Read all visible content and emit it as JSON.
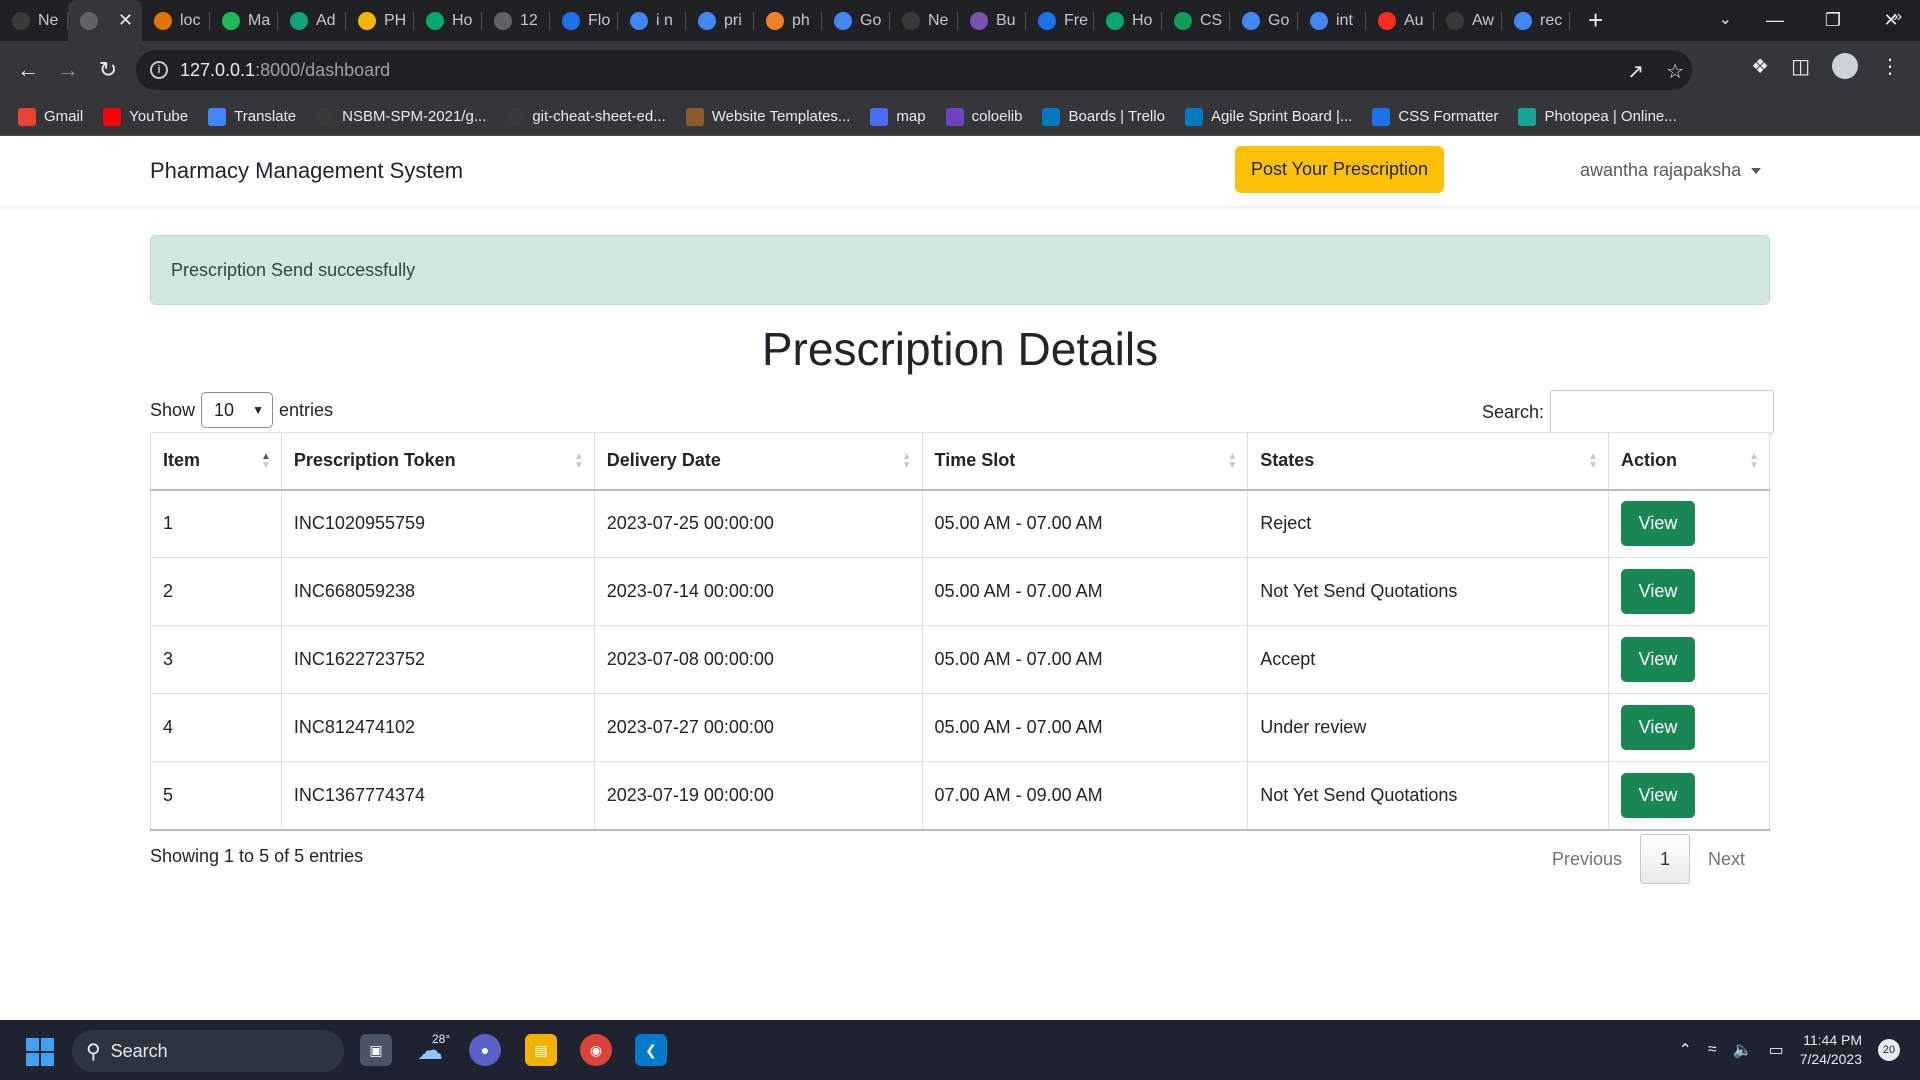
{
  "browser": {
    "tabs": [
      {
        "label": "Ne",
        "icon": "github-icon",
        "color": "#3a3a3a"
      },
      {
        "label": "",
        "icon": "globe-icon",
        "color": "#5f6368",
        "active": true
      },
      {
        "label": "loc",
        "icon": "flame-icon",
        "color": "#e37400"
      },
      {
        "label": "Ma",
        "icon": "m-icon",
        "color": "#1db954"
      },
      {
        "label": "Ad",
        "icon": "openai-icon",
        "color": "#10a37f"
      },
      {
        "label": "PH",
        "icon": "drive-icon",
        "color": "#f4b400"
      },
      {
        "label": "Ho",
        "icon": "w3-icon",
        "color": "#04aa6d"
      },
      {
        "label": "12",
        "icon": "globe-icon",
        "color": "#5f6368"
      },
      {
        "label": "Flo",
        "icon": "search-icon",
        "color": "#1a73e8"
      },
      {
        "label": "i n",
        "icon": "google-icon",
        "color": "#4285f4"
      },
      {
        "label": "pri",
        "icon": "google-icon",
        "color": "#4285f4"
      },
      {
        "label": "ph",
        "icon": "stack-icon",
        "color": "#f48024"
      },
      {
        "label": "Go",
        "icon": "translate-icon",
        "color": "#4285f4"
      },
      {
        "label": "Ne",
        "icon": "github-icon",
        "color": "#3a3a3a"
      },
      {
        "label": "Bu",
        "icon": "bootstrap-icon",
        "color": "#7952b3"
      },
      {
        "label": "Fre",
        "icon": "globe-icon",
        "color": "#1a73e8"
      },
      {
        "label": "Ho",
        "icon": "w3-icon",
        "color": "#04aa6d"
      },
      {
        "label": "CS",
        "icon": "w-icon",
        "color": "#0f9d58"
      },
      {
        "label": "Go",
        "icon": "translate-icon",
        "color": "#4285f4"
      },
      {
        "label": "int",
        "icon": "google-icon",
        "color": "#4285f4"
      },
      {
        "label": "Au",
        "icon": "laravel-icon",
        "color": "#ff2d20"
      },
      {
        "label": "Aw",
        "icon": "github-icon",
        "color": "#3a3a3a"
      },
      {
        "label": "rec",
        "icon": "google-icon",
        "color": "#4285f4"
      }
    ],
    "url_host": "127.0.0.1",
    "url_path": ":8000/dashboard",
    "bookmarks": [
      {
        "label": "Gmail",
        "icon": "gmail-icon",
        "color": "#ea4335"
      },
      {
        "label": "YouTube",
        "icon": "youtube-icon",
        "color": "#ff0000"
      },
      {
        "label": "Translate",
        "icon": "translate-icon",
        "color": "#4285f4"
      },
      {
        "label": "NSBM-SPM-2021/g...",
        "icon": "github-icon",
        "color": "#3a3a3a"
      },
      {
        "label": "git-cheat-sheet-ed...",
        "icon": "github-icon",
        "color": "#3a3a3a"
      },
      {
        "label": "Website Templates...",
        "icon": "template-icon",
        "color": "#8a5a2b"
      },
      {
        "label": "map",
        "icon": "map-icon",
        "color": "#4a6cf7"
      },
      {
        "label": "coloelib",
        "icon": "colorlib-icon",
        "color": "#6f42c1"
      },
      {
        "label": "Boards | Trello",
        "icon": "trello-icon",
        "color": "#0079bf"
      },
      {
        "label": "Agile Sprint Board |...",
        "icon": "trello-icon",
        "color": "#0079bf"
      },
      {
        "label": "CSS Formatter",
        "icon": "dans-tools-icon",
        "color": "#1a73e8"
      },
      {
        "label": "Photopea | Online...",
        "icon": "photopea-icon",
        "color": "#18a497"
      }
    ]
  },
  "navbar": {
    "brand": "Pharmacy Management System",
    "post_button": "Post Your Prescription",
    "user_name": "awantha rajapaksha"
  },
  "alert": {
    "message": "Prescription Send successfully"
  },
  "title": "Prescription Details",
  "table_controls": {
    "show_label": "Show",
    "entries_value": "10",
    "entries_label": "entries",
    "search_label": "Search:",
    "search_value": ""
  },
  "table": {
    "columns": [
      "Item",
      "Prescription Token",
      "Delivery Date",
      "Time Slot",
      "States",
      "Action"
    ],
    "rows": [
      {
        "item": "1",
        "token": "INC1020955759",
        "date": "2023-07-25 00:00:00",
        "slot": "05.00 AM - 07.00 AM",
        "state": "Reject",
        "action": "View"
      },
      {
        "item": "2",
        "token": "INC668059238",
        "date": "2023-07-14 00:00:00",
        "slot": "05.00 AM - 07.00 AM",
        "state": "Not Yet Send Quotations",
        "action": "View"
      },
      {
        "item": "3",
        "token": "INC1622723752",
        "date": "2023-07-08 00:00:00",
        "slot": "05.00 AM - 07.00 AM",
        "state": "Accept",
        "action": "View"
      },
      {
        "item": "4",
        "token": "INC812474102",
        "date": "2023-07-27 00:00:00",
        "slot": "05.00 AM - 07.00 AM",
        "state": "Under review",
        "action": "View"
      },
      {
        "item": "5",
        "token": "INC1367774374",
        "date": "2023-07-19 00:00:00",
        "slot": "07.00 AM - 09.00 AM",
        "state": "Not Yet Send Quotations",
        "action": "View"
      }
    ]
  },
  "pagination": {
    "info": "Showing 1 to 5 of 5 entries",
    "previous": "Previous",
    "current_page": "1",
    "next": "Next"
  },
  "taskbar": {
    "search_label": "Search",
    "temperature": "28°",
    "time": "11:44 PM",
    "date": "7/24/2023",
    "notifications": "20"
  },
  "colors": {
    "accent_yellow": "#ffc107",
    "view_button": "#198754",
    "alert_bg": "#d1e7dd"
  }
}
